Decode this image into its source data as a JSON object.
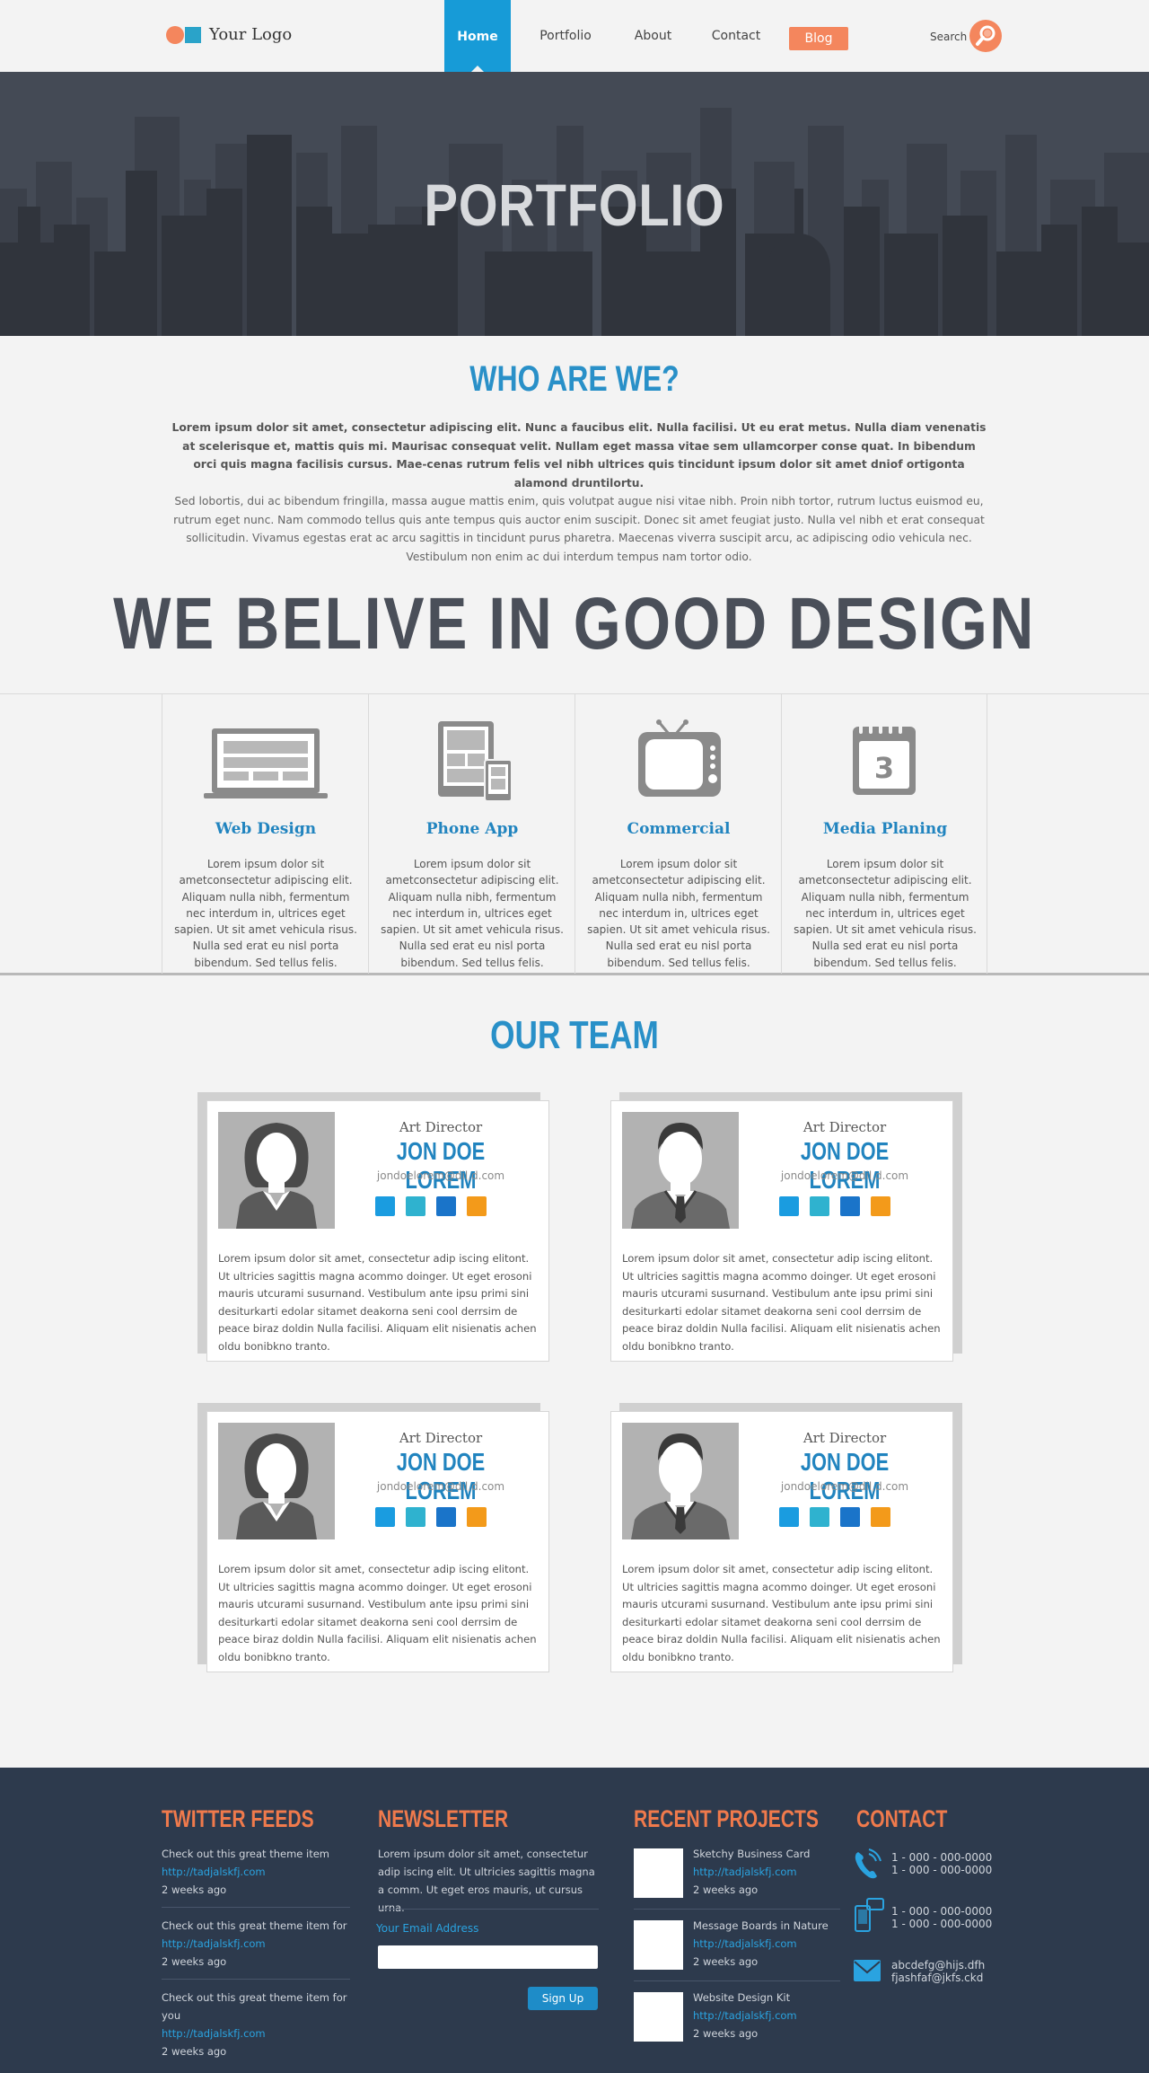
{
  "header": {
    "logo_text": "Your Logo",
    "nav": [
      "Home",
      "Portfolio",
      "About",
      "Contact",
      "Blog"
    ],
    "search_label": "Search"
  },
  "hero": {
    "title": "PORTFOLIO"
  },
  "about": {
    "title": "WHO ARE WE?",
    "lead": "Lorem ipsum dolor sit amet, consectetur adipiscing elit. Nunc a faucibus elit. Nulla facilisi. Ut eu erat metus. Nulla diam venenatis at scelerisque et, mattis quis mi. Maurisac consequat velit. Nullam eget massa vitae sem ullamcorper conse quat. In bibendum orci quis magna facilisis cursus. Mae-cenas rutrum felis vel nibh ultrices quis tincidunt ipsum dolor sit amet dniof ortigonta alamond druntilortu.",
    "body": "Sed lobortis, dui ac bibendum fringilla, massa augue mattis enim, quis volutpat augue nisi vitae nibh. Proin nibh tortor, rutrum luctus euismod eu, rutrum eget nunc. Nam commodo tellus quis ante tempus quis auctor enim suscipit. Donec sit amet feugiat justo. Nulla vel nibh et erat consequat sollicitudin. Vivamus egestas erat ac arcu sagittis in tincidunt purus pharetra. Maecenas viverra suscipit arcu, ac adipiscing odio vehicula nec. Vestibulum non enim ac dui interdum tempus nam tortor odio.",
    "tagline": "WE BELIVE IN GOOD DESIGN"
  },
  "services": [
    {
      "icon": "laptop-icon",
      "title": "Web Design",
      "text": "Lorem ipsum dolor sit ametconsectetur adipiscing elit. Aliquam nulla nibh, fermentum nec interdum in, ultrices eget sapien. Ut sit amet vehicula risus. Nulla sed erat eu nisl porta bibendum. Sed tellus felis."
    },
    {
      "icon": "tablet-phone-icon",
      "title": "Phone App",
      "text": "Lorem ipsum dolor sit ametconsectetur adipiscing elit. Aliquam nulla nibh, fermentum nec interdum in, ultrices eget sapien. Ut sit amet vehicula risus. Nulla sed erat eu nisl porta bibendum. Sed tellus felis."
    },
    {
      "icon": "tv-icon",
      "title": "Commercial",
      "text": "Lorem ipsum dolor sit ametconsectetur adipiscing elit. Aliquam nulla nibh, fermentum nec interdum in, ultrices eget sapien. Ut sit amet vehicula risus. Nulla sed erat eu nisl porta bibendum. Sed tellus felis."
    },
    {
      "icon": "calendar-icon",
      "calendar_day": "3",
      "title": "Media Planing",
      "text": "Lorem ipsum dolor sit ametconsectetur adipiscing elit. Aliquam nulla nibh, fermentum nec interdum in, ultrices eget sapien. Ut sit amet vehicula risus. Nulla sed erat eu nisl porta bibendum. Sed tellus felis."
    }
  ],
  "team": {
    "title": "OUR TEAM",
    "members": [
      {
        "avatar": "female-avatar-icon",
        "role": "Art Director",
        "name": "JON DOE LOREM",
        "email": "jondoelorem@dil,d.com",
        "text": "Lorem ipsum dolor sit amet, consectetur adip iscing elitont. Ut ultricies sagittis magna acommo doinger. Ut eget erosoni mauris utcurami susurnand. Vestibulum ante ipsu  primi sini  desiturkarti edolar sitamet deakorna seni cool derrsim de peace biraz doldin Nulla facilisi. Aliquam elit nisienatis achen oldu bonibkno tranto."
      },
      {
        "avatar": "male-avatar-icon",
        "role": "Art Director",
        "name": "JON DOE LOREM",
        "email": "jondoelorem@dil,d.com",
        "text": "Lorem ipsum dolor sit amet, consectetur adip iscing elitont. Ut ultricies sagittis magna acommo doinger. Ut eget erosoni mauris utcurami susurnand. Vestibulum ante ipsu  primi sini  desiturkarti edolar sitamet deakorna seni cool derrsim de peace biraz doldin Nulla facilisi. Aliquam elit nisienatis achen oldu bonibkno tranto."
      },
      {
        "avatar": "female-avatar-icon",
        "role": "Art Director",
        "name": "JON DOE LOREM",
        "email": "jondoelorem@dil,d.com",
        "text": "Lorem ipsum dolor sit amet, consectetur adip iscing elitont. Ut ultricies sagittis magna acommo doinger. Ut eget erosoni mauris utcurami susurnand. Vestibulum ante ipsu  primi sini  desiturkarti edolar sitamet deakorna seni cool derrsim de peace biraz doldin Nulla facilisi. Aliquam elit nisienatis achen oldu bonibkno tranto."
      },
      {
        "avatar": "male-avatar-icon",
        "role": "Art Director",
        "name": "JON DOE LOREM",
        "email": "jondoelorem@dil,d.com",
        "text": "Lorem ipsum dolor sit amet, consectetur adip iscing elitont. Ut ultricies sagittis magna acommo doinger. Ut eget erosoni mauris utcurami susurnand. Vestibulum ante ipsu  primi sini  desiturkarti edolar sitamet deakorna seni cool derrsim de peace biraz doldin Nulla facilisi. Aliquam elit nisienatis achen oldu bonibkno tranto."
      }
    ],
    "social_colors": [
      "#1a9ce0",
      "#2fb2cf",
      "#1a74c9",
      "#f39a1a"
    ]
  },
  "footer": {
    "twitter": {
      "title": "TWITTER FEEDS",
      "items": [
        {
          "text": "Check out this great theme item",
          "link": "http://tadjalskfj.com",
          "time": "2 weeks ago"
        },
        {
          "text": "Check out this great theme item for",
          "link": "http://tadjalskfj.com",
          "time": "2 weeks ago"
        },
        {
          "text": "Check out this great theme item for you",
          "link": "http://tadjalskfj.com",
          "time": "2 weeks ago"
        }
      ]
    },
    "newsletter": {
      "title": "NEWSLETTER",
      "text": "Lorem ipsum dolor sit amet, consectetur adip iscing elit. Ut ultricies sagittis magna a comm. Ut eget eros mauris, ut cursus urna.",
      "email_label": "Your Email Address",
      "button": "Sign Up"
    },
    "projects": {
      "title": "RECENT PROJECTS",
      "items": [
        {
          "name": "Sketchy Business Card",
          "link": "http://tadjalskfj.com",
          "time": "2 weeks ago"
        },
        {
          "name": "Message Boards in Nature",
          "link": "http://tadjalskfj.com",
          "time": "2 weeks ago"
        },
        {
          "name": "Website Design Kit",
          "link": "http://tadjalskfj.com",
          "time": "2 weeks ago"
        }
      ]
    },
    "contact": {
      "title": "CONTACT",
      "phone": [
        "1 - 000 - 000-0000",
        "1 - 000 - 000-0000"
      ],
      "mobile": [
        "1 - 000 - 000-0000",
        "1 - 000 - 000-0000"
      ],
      "email": [
        "abcdefg@hijs.dfh",
        "fjashfaf@jkfs.ckd"
      ]
    }
  },
  "colors": {
    "accent": "#f4865d",
    "primary_blue": "#2990c8",
    "footer_bg": "#2d3a4d",
    "hero_bg": "#444a55"
  }
}
